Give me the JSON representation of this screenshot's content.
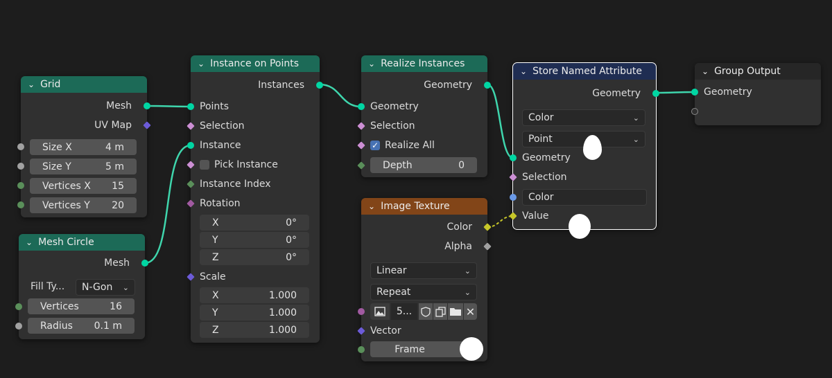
{
  "nodes": {
    "grid": {
      "title": "Grid",
      "out_mesh": "Mesh",
      "out_uvmap": "UV Map",
      "size_x_label": "Size X",
      "size_x_value": "4 m",
      "size_y_label": "Size Y",
      "size_y_value": "5 m",
      "vert_x_label": "Vertices X",
      "vert_x_value": "15",
      "vert_y_label": "Vertices Y",
      "vert_y_value": "20"
    },
    "mesh_circle": {
      "title": "Mesh Circle",
      "out_mesh": "Mesh",
      "fill_type_label": "Fill Ty...",
      "fill_type_value": "N-Gon",
      "vertices_label": "Vertices",
      "vertices_value": "16",
      "radius_label": "Radius",
      "radius_value": "0.1 m"
    },
    "instance_on_points": {
      "title": "Instance on Points",
      "out_instances": "Instances",
      "in_points": "Points",
      "in_selection": "Selection",
      "in_instance": "Instance",
      "pick_instance": "Pick Instance",
      "in_instance_index": "Instance Index",
      "in_rotation": "Rotation",
      "rot_x_label": "X",
      "rot_x_value": "0°",
      "rot_y_label": "Y",
      "rot_y_value": "0°",
      "rot_z_label": "Z",
      "rot_z_value": "0°",
      "in_scale": "Scale",
      "scale_x_label": "X",
      "scale_x_value": "1.000",
      "scale_y_label": "Y",
      "scale_y_value": "1.000",
      "scale_z_label": "Z",
      "scale_z_value": "1.000"
    },
    "realize_instances": {
      "title": "Realize Instances",
      "out_geometry": "Geometry",
      "in_geometry": "Geometry",
      "in_selection": "Selection",
      "realize_all": "Realize All",
      "depth_label": "Depth",
      "depth_value": "0"
    },
    "image_texture": {
      "title": "Image Texture",
      "out_color": "Color",
      "out_alpha": "Alpha",
      "interpolation": "Linear",
      "extension": "Repeat",
      "image_name": "5...",
      "in_vector": "Vector",
      "frame_label": "Frame"
    },
    "store_named_attribute": {
      "title": "Store Named Attribute",
      "out_geometry": "Geometry",
      "data_type": "Color",
      "domain": "Point",
      "in_geometry": "Geometry",
      "in_selection": "Selection",
      "name_value": "Color",
      "in_value": "Value"
    },
    "group_output": {
      "title": "Group Output",
      "in_geometry": "Geometry"
    }
  },
  "colors": {
    "geometry_socket": "#00d6a3",
    "field_socket": "#cc8fd4",
    "vector_socket": "#6c5bd8",
    "float_socket": "#a1a1a1",
    "int_socket": "#5a8f5a",
    "color_socket": "#c7c729",
    "string_socket": "#6a9ae8",
    "header_geometry": "#1c6a57",
    "header_texture": "#824518",
    "header_attribute": "#1f2d52"
  }
}
